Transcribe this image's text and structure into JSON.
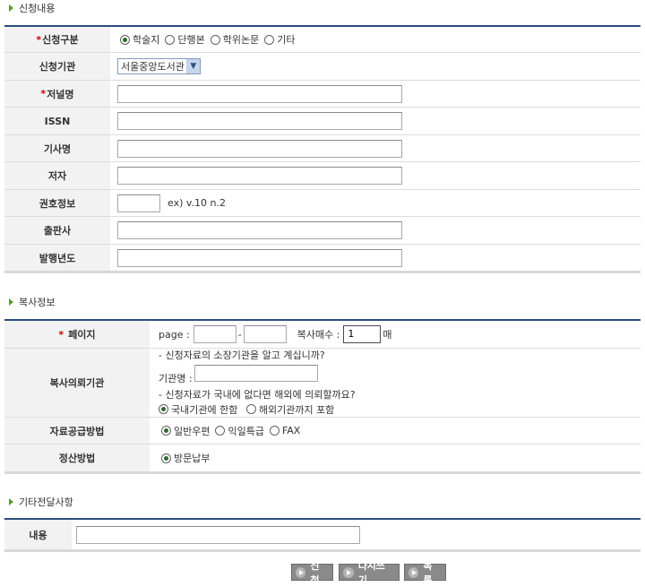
{
  "request_section": {
    "title": "신청내용",
    "type_label": "신청구분",
    "type_options": [
      "학술지",
      "단행본",
      "학위논문",
      "기타"
    ],
    "type_selected": 0,
    "library_label": "신청기관",
    "library_value": "서울중앙도서관",
    "journal_label": "저널명",
    "issn_label": "ISSN",
    "article_label": "기사명",
    "author_label": "저자",
    "volume_label": "권호정보",
    "volume_hint": "ex) v.10 n.2",
    "publisher_label": "출판사",
    "year_label": "발행년도",
    "required_mark": "*"
  },
  "copy_section": {
    "title": "복사정보",
    "page_label": "페이지",
    "page_prefix": "page :",
    "page_dash": "-",
    "copies_label": "복사매수 :",
    "copies_value": "1",
    "copies_unit": "매",
    "agency_label": "복사의뢰기관",
    "agency_q1": "- 신청자료의 소장기관을 알고 계십니까?",
    "agency_name_label": "기관명 :",
    "agency_q2": "- 신청자료가 국내에 없다면 해외에 의뢰할까요?",
    "agency_options": [
      "국내기관에 한함",
      "해외기관까지 포함"
    ],
    "agency_selected": 0,
    "supply_label": "자료공급방법",
    "supply_options": [
      "일반우편",
      "익일특급",
      "FAX"
    ],
    "supply_selected": 0,
    "payment_label": "정산방법",
    "payment_options": [
      "방문납부"
    ],
    "payment_selected": 0,
    "required_mark": "*"
  },
  "etc_section": {
    "title": "기타전달사항",
    "content_label": "내용"
  },
  "buttons": {
    "submit": "신청",
    "reset": "다시쓰기",
    "list": "목록"
  },
  "colors": {
    "header_line": "#2a4d7a",
    "label_bg": "#f2f2f2",
    "bullet": "#5a9a2a",
    "button_bg": "#8a8a8a"
  }
}
